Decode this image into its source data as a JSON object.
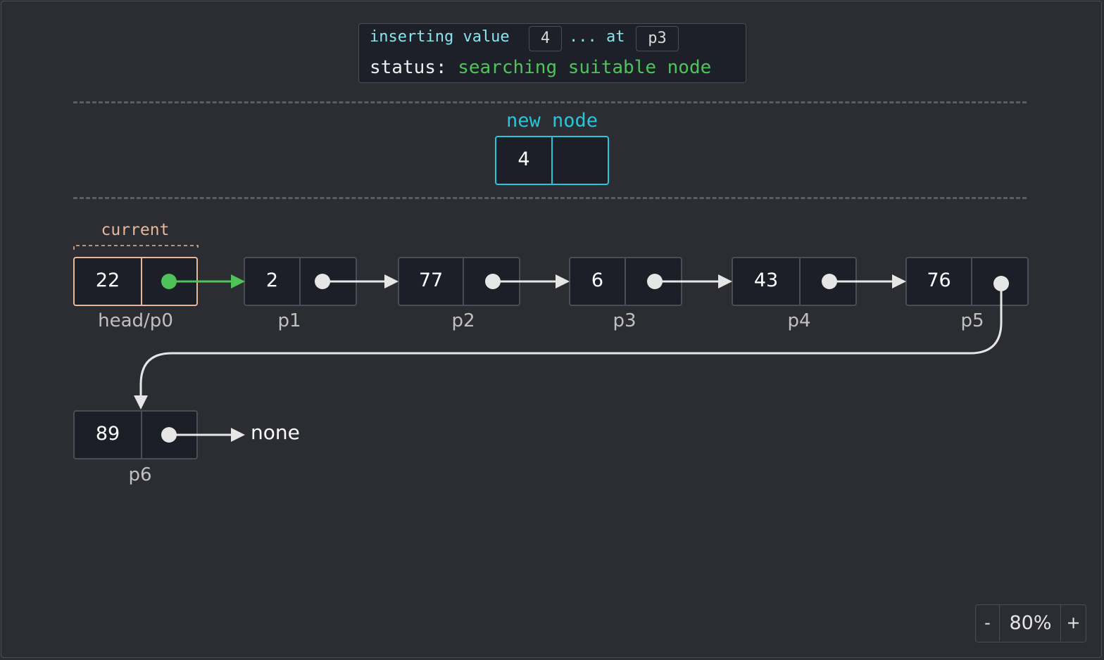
{
  "header": {
    "inserting_label": "inserting value",
    "value": "4",
    "at_label": "... at",
    "position": "p3",
    "status_label": "status:",
    "status_text": "searching suitable node"
  },
  "new_node": {
    "label": "new node",
    "value": "4"
  },
  "current_label": "current",
  "nodes": [
    {
      "value": "22",
      "label": "head/p0"
    },
    {
      "value": "2",
      "label": "p1"
    },
    {
      "value": "77",
      "label": "p2"
    },
    {
      "value": "6",
      "label": "p3"
    },
    {
      "value": "43",
      "label": "p4"
    },
    {
      "value": "76",
      "label": "p5"
    },
    {
      "value": "89",
      "label": "p6"
    }
  ],
  "terminal": "none",
  "zoom": {
    "minus": "-",
    "value": "80%",
    "plus": "+"
  },
  "colors": {
    "background": "#2b2d33",
    "node_fill": "#1c1f27",
    "node_border": "#4a4d55",
    "current": "#e8b79a",
    "new_node": "#26c6da",
    "active_pointer": "#4fc35a",
    "pointer": "#e6e6e6",
    "status": "#4fc35a"
  }
}
